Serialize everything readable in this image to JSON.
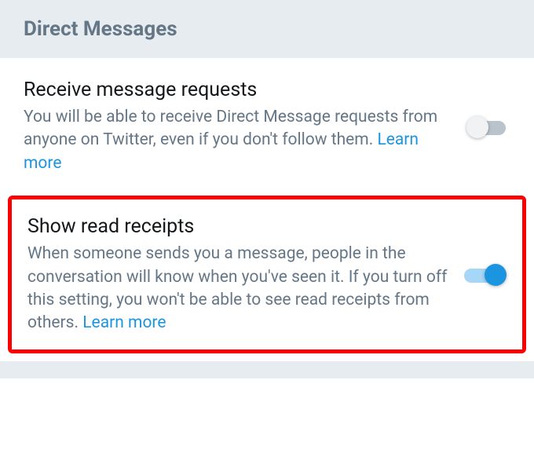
{
  "header": {
    "title": "Direct Messages"
  },
  "settings": {
    "receive_requests": {
      "title": "Receive message requests",
      "description": "You will be able to receive Direct Message requests from anyone on Twitter, even if you don't follow them. ",
      "learn_more": "Learn more",
      "enabled": false
    },
    "read_receipts": {
      "title": "Show read receipts",
      "description": "When someone sends you a message, people in the conversation will know when you've seen it. If you turn off this setting, you won't be able to see read receipts from others. ",
      "learn_more": "Learn more",
      "enabled": true
    }
  }
}
